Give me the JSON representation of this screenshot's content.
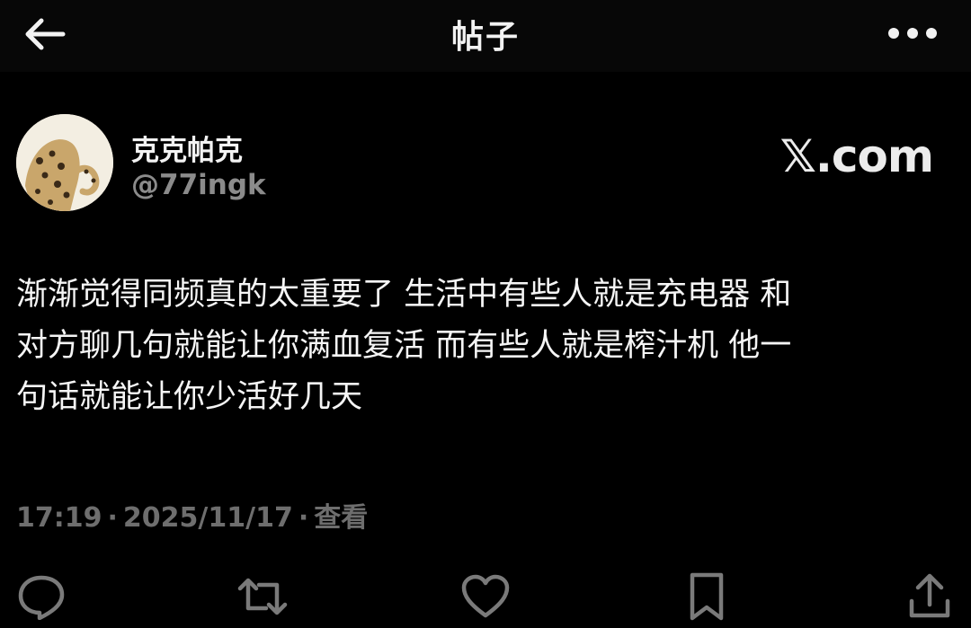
{
  "header": {
    "title": "帖子",
    "back_icon": "arrow-left-icon",
    "more_icon": "more-horizontal-icon"
  },
  "author": {
    "display_name": "克克帕克",
    "handle": "@77ingk",
    "avatar_icon": "leopard-avatar"
  },
  "source": {
    "label": "𝕏.com"
  },
  "post": {
    "text": "渐渐觉得同频真的太重要了 生活中有些人就是充电器 和\n对方聊几句就能让你满血复活 而有些人就是榨汁机 他一\n句话就能让你少活好几天"
  },
  "meta": {
    "time": "17:19",
    "date": "2025/11/17",
    "views": "查看",
    "separator": "·"
  },
  "actions": [
    {
      "name": "reply",
      "icon": "comment-icon"
    },
    {
      "name": "repost",
      "icon": "repost-icon"
    },
    {
      "name": "like",
      "icon": "heart-icon"
    },
    {
      "name": "bookmark",
      "icon": "bookmark-icon"
    },
    {
      "name": "share",
      "icon": "share-icon"
    }
  ],
  "colors": {
    "background": "#000000",
    "text_primary": "#f5f5f5",
    "text_secondary": "#8b8b8b",
    "meta": "#6e6e6e"
  }
}
